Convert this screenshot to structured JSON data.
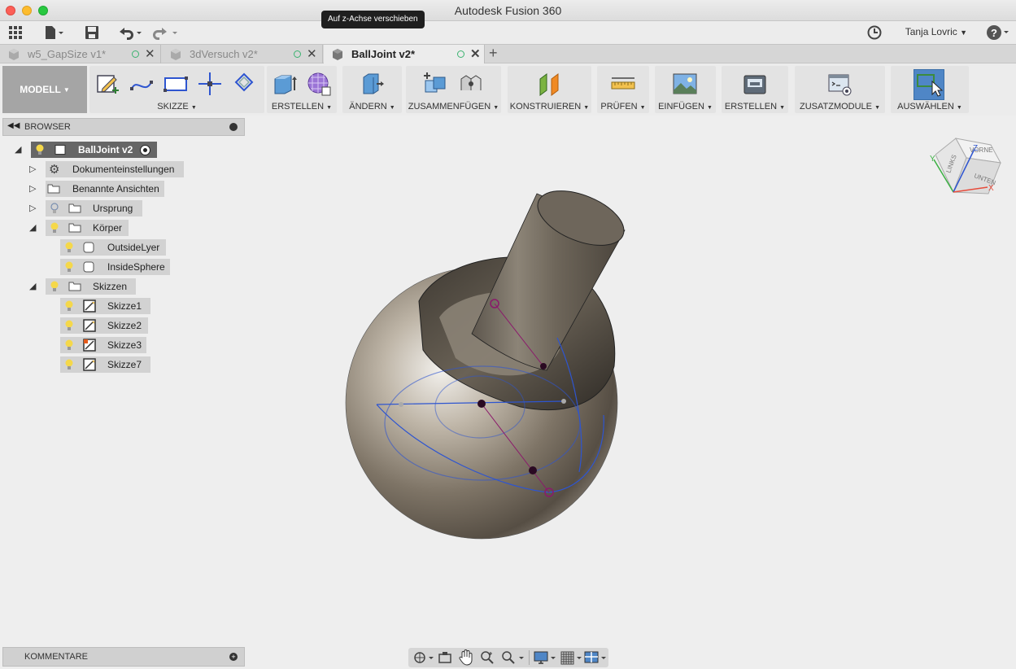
{
  "app": {
    "title": "Autodesk Fusion 360"
  },
  "tooltip": {
    "text": "Auf z-Achse verschieben"
  },
  "user": {
    "name": "Tanja Lovric"
  },
  "tabs": [
    {
      "label": "w5_GapSize v1*"
    },
    {
      "label": "3dVersuch v2*"
    },
    {
      "label": "BallJoint v2*"
    }
  ],
  "toolbar": {
    "workspace": "MODELL",
    "groups": [
      {
        "label": "SKIZZE"
      },
      {
        "label": "ERSTELLEN"
      },
      {
        "label": "ÄNDERN"
      },
      {
        "label": "ZUSAMMENFÜGEN"
      },
      {
        "label": "KONSTRUIEREN"
      },
      {
        "label": "PRÜFEN"
      },
      {
        "label": "EINFÜGEN"
      },
      {
        "label": "ERSTELLEN"
      },
      {
        "label": "ZUSATZMODULE"
      },
      {
        "label": "AUSWÄHLEN"
      }
    ]
  },
  "browser": {
    "title": "BROWSER",
    "root": "BallJoint v2",
    "items": [
      {
        "label": "Dokumenteinstellungen"
      },
      {
        "label": "Benannte Ansichten"
      },
      {
        "label": "Ursprung"
      },
      {
        "label": "Körper"
      },
      {
        "label": "OutsideLyer"
      },
      {
        "label": "InsideSphere"
      },
      {
        "label": "Skizzen"
      },
      {
        "label": "Skizze1"
      },
      {
        "label": "Skizze2"
      },
      {
        "label": "Skizze3"
      },
      {
        "label": "Skizze7"
      }
    ]
  },
  "comments": {
    "title": "KOMMENTARE"
  },
  "viewcube": {
    "faces": [
      "LINKS",
      "VORNE",
      "UNTEN"
    ],
    "axes": [
      "Y",
      "Z",
      "X"
    ]
  },
  "colors": {
    "accent": "#4a90d9",
    "selectActive": "#4f86c6",
    "sketchLine": "#2e55d0",
    "constraint": "#8b1a6b"
  }
}
